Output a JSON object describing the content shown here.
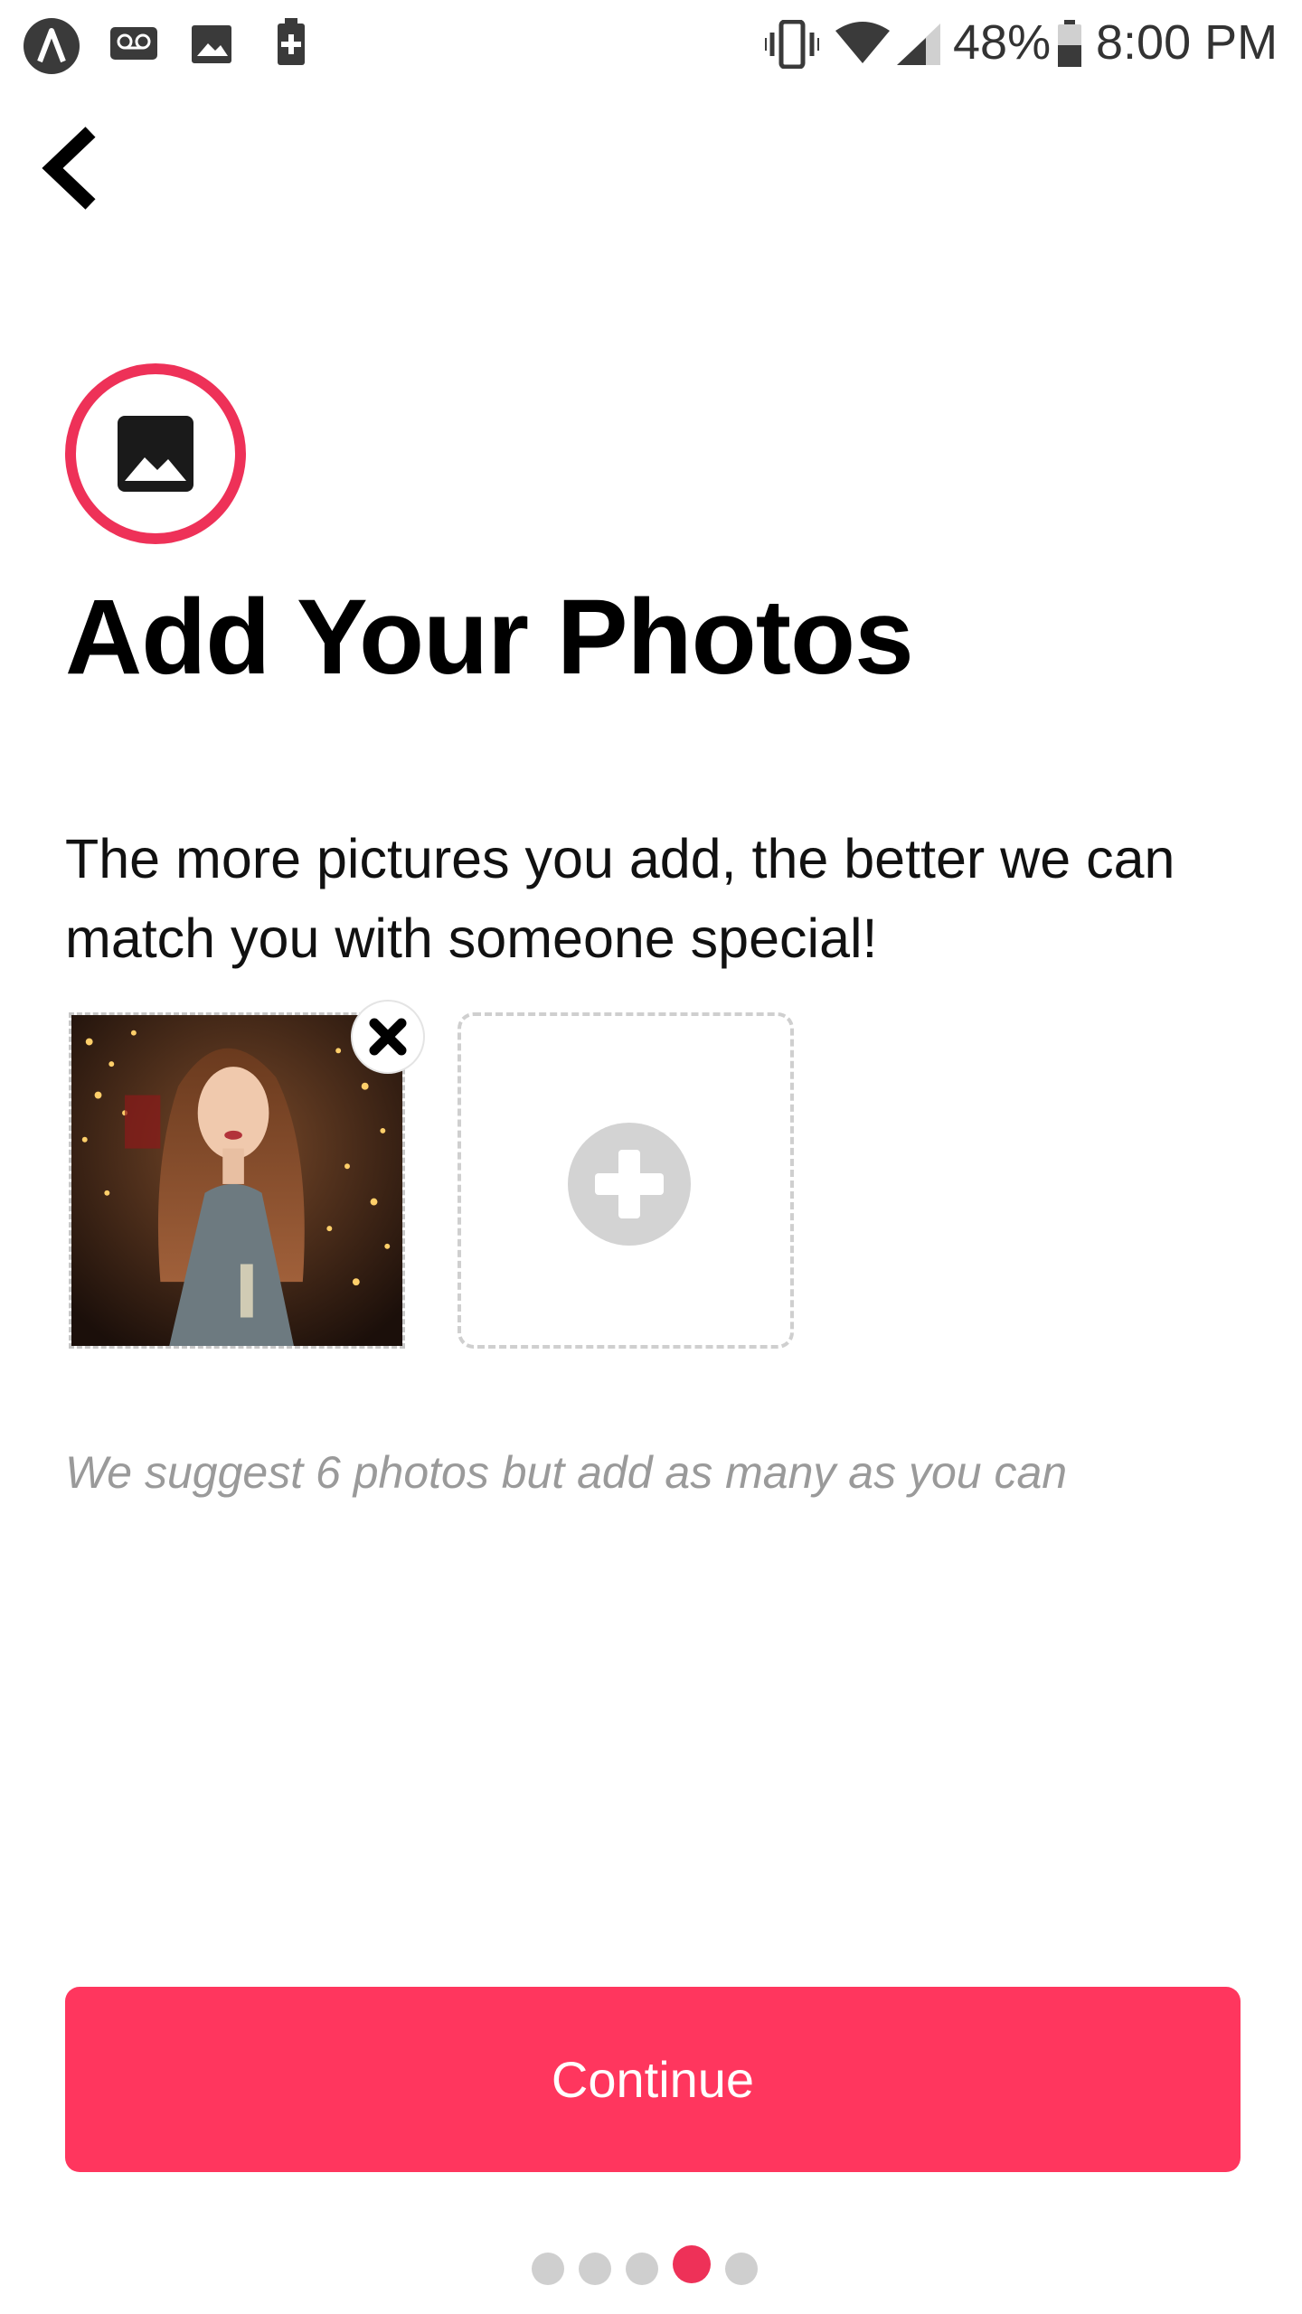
{
  "status_bar": {
    "battery_percent": "48%",
    "time": "8:00 PM",
    "icons": [
      "app-lambda-icon",
      "voicemail-icon",
      "gallery-icon",
      "battery-saver-icon",
      "vibrate-icon",
      "wifi-icon",
      "signal-icon",
      "battery-icon"
    ]
  },
  "header": {
    "back_icon": "chevron-left-icon",
    "title": "Add Your Photos",
    "subtitle": "The more pictures you add, the better we can match you with someone special!"
  },
  "photos": {
    "slots": [
      {
        "state": "filled",
        "remove_icon": "close-icon"
      },
      {
        "state": "empty",
        "add_icon": "plus-circle-icon"
      }
    ],
    "suggestion": "We suggest 6 photos but add as many as you can"
  },
  "actions": {
    "continue_label": "Continue"
  },
  "pager": {
    "total": 5,
    "current": 4
  },
  "colors": {
    "accent": "#ff365e",
    "icon_ring": "#ee3158",
    "muted_text": "#9a9a9a",
    "dashed_border": "#cfcfcf"
  }
}
